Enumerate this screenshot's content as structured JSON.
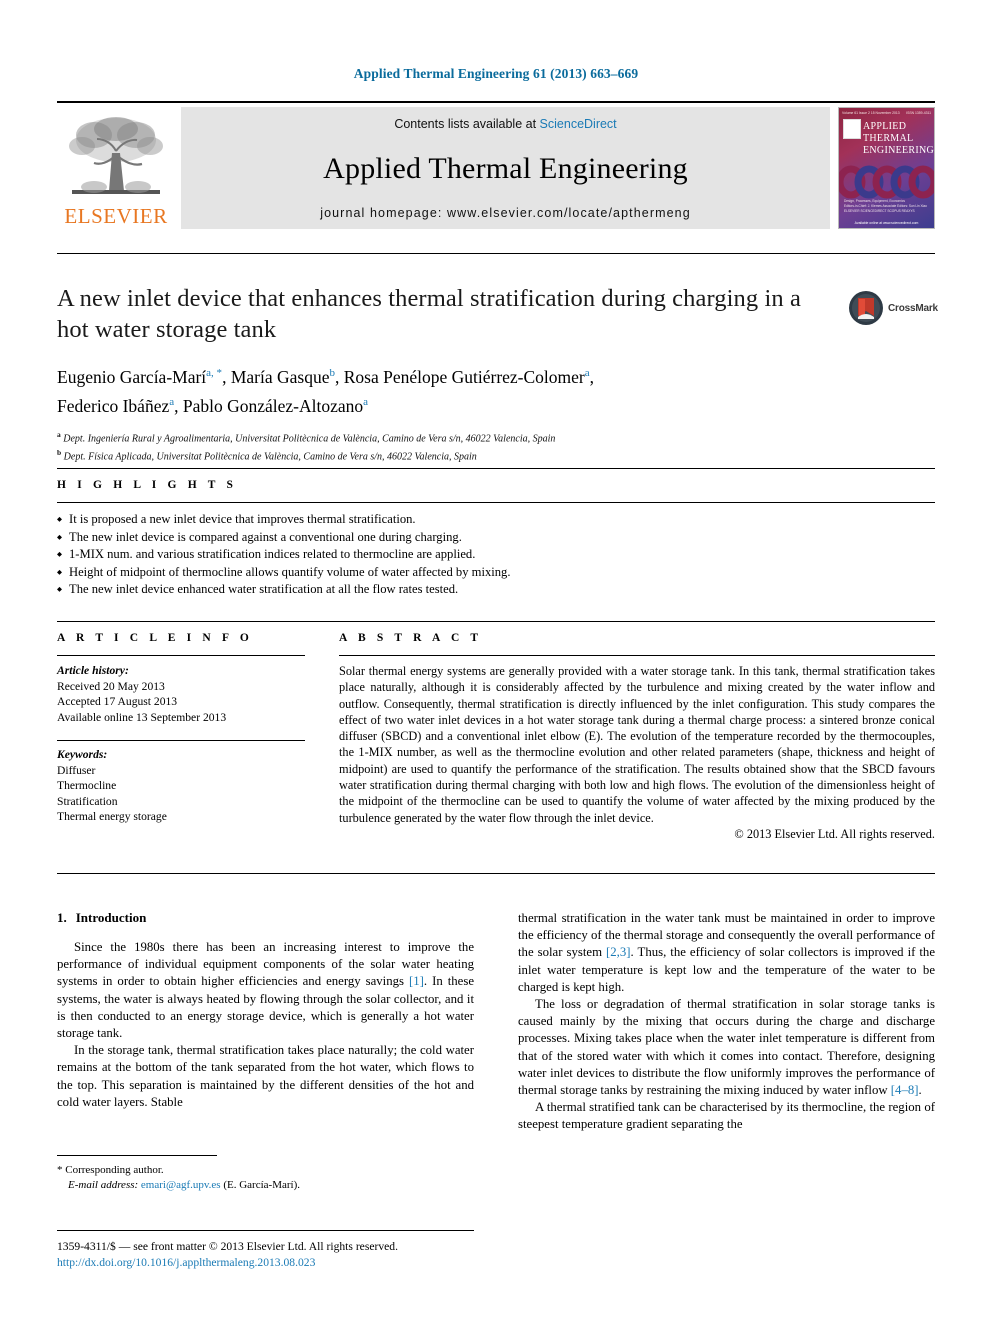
{
  "running_head": "Applied Thermal Engineering 61 (2013) 663–669",
  "masthead": {
    "publisher_name": "ELSEVIER",
    "contents_prefix": "Contents lists available at",
    "contents_link": "ScienceDirect",
    "journal_name": "Applied Thermal Engineering",
    "homepage": "journal homepage: www.elsevier.com/locate/apthermeng",
    "cover": {
      "line1": "APPLIED",
      "line2": "THERMAL",
      "line3": "ENGINEERING",
      "corner_left": "Volume 61  Issue 2  15 November 2013",
      "corner_right": "ISSN 1359-4311",
      "footer_a": "Design, Processes, Equipment, Economics",
      "footer_b": "Editors-in-Chief: J. Klemes  Associate Editors: Sun Lin Xiao",
      "footer_c": "ELSEVIER       SCIENCEDIRECT       SCOPUS       REAXYS",
      "badge": "Available online at www.sciencedirect.com"
    }
  },
  "article": {
    "title": "A new inlet device that enhances thermal stratification during charging in a hot water storage tank",
    "crossmark_label": "CrossMark",
    "authors": [
      {
        "name": "Eugenio García-Marí",
        "marks": "a, *"
      },
      {
        "name": "María Gasque",
        "marks": "b"
      },
      {
        "name": "Rosa Penélope Gutiérrez-Colomer",
        "marks": "a"
      },
      {
        "name": "Federico Ibáñez",
        "marks": "a"
      },
      {
        "name": "Pablo González-Altozano",
        "marks": "a"
      }
    ],
    "affiliations": [
      {
        "mark": "a",
        "text": "Dept. Ingeniería Rural y Agroalimentaria, Universitat Politècnica de València, Camino de Vera s/n, 46022 Valencia, Spain"
      },
      {
        "mark": "b",
        "text": "Dept. Física Aplicada, Universitat Politècnica de València, Camino de Vera s/n, 46022 Valencia, Spain"
      }
    ]
  },
  "highlights": {
    "label": "H I G H L I G H T S",
    "items": [
      "It is proposed a new inlet device that improves thermal stratification.",
      "The new inlet device is compared against a conventional one during charging.",
      "1-MIX num. and various stratification indices related to thermocline are applied.",
      "Height of midpoint of thermocline allows quantify volume of water affected by mixing.",
      "The new inlet device enhanced water stratification at all the flow rates tested."
    ]
  },
  "article_info": {
    "label": "A R T I C L E   I N F O",
    "history_label": "Article history:",
    "history": [
      "Received 20 May 2013",
      "Accepted 17 August 2013",
      "Available online 13 September 2013"
    ],
    "keywords_label": "Keywords:",
    "keywords": [
      "Diffuser",
      "Thermocline",
      "Stratification",
      "Thermal energy storage"
    ]
  },
  "abstract": {
    "label": "A B S T R A C T",
    "text": "Solar thermal energy systems are generally provided with a water storage tank. In this tank, thermal stratification takes place naturally, although it is considerably affected by the turbulence and mixing created by the water inflow and outflow. Consequently, thermal stratification is directly influenced by the inlet configuration. This study compares the effect of two water inlet devices in a hot water storage tank during a thermal charge process: a sintered bronze conical diffuser (SBCD) and a conventional inlet elbow (E). The evolution of the temperature recorded by the thermocouples, the 1-MIX number, as well as the thermocline evolution and other related parameters (shape, thickness and height of midpoint) are used to quantify the performance of the stratification. The results obtained show that the SBCD favours water stratification during thermal charging with both low and high flows. The evolution of the dimensionless height of the midpoint of the thermocline can be used to quantify the volume of water affected by the mixing produced by the turbulence generated by the water flow through the inlet device.",
    "copyright": "© 2013 Elsevier Ltd. All rights reserved."
  },
  "introduction": {
    "number": "1.",
    "heading": "Introduction",
    "left_paragraphs": [
      "Since the 1980s there has been an increasing interest to improve the performance of individual equipment components of the solar water heating systems in order to obtain higher efficiencies and energy savings [1]. In these systems, the water is always heated by flowing through the solar collector, and it is then conducted to an energy storage device, which is generally a hot water storage tank.",
      "In the storage tank, thermal stratification takes place naturally; the cold water remains at the bottom of the tank separated from the hot water, which flows to the top. This separation is maintained by the different densities of the hot and cold water layers. Stable"
    ],
    "right_paragraphs": [
      "thermal stratification in the water tank must be maintained in order to improve the efficiency of the thermal storage and consequently the overall performance of the solar system [2,3]. Thus, the efficiency of solar collectors is improved if the inlet water temperature is kept low and the temperature of the water to be charged is kept high.",
      "The loss or degradation of thermal stratification in solar storage tanks is caused mainly by the mixing that occurs during the charge and discharge processes. Mixing takes place when the water inlet temperature is different from that of the stored water with which it comes into contact. Therefore, designing water inlet devices to distribute the flow uniformly improves the performance of thermal storage tanks by restraining the mixing induced by water inflow [4–8].",
      "A thermal stratified tank can be characterised by its thermocline, the region of steepest temperature gradient separating the"
    ],
    "refs": {
      "r1": "[1]",
      "r23": "[2,3]",
      "r48": "[4–8]"
    }
  },
  "footnote": {
    "corresponding_marker": "*",
    "corresponding_label": "Corresponding author.",
    "email_label": "E-mail address:",
    "email": "emari@agf.upv.es",
    "email_owner": "(E. García-Marí)."
  },
  "footer": {
    "issn_line": "1359-4311/$ — see front matter © 2013 Elsevier Ltd. All rights reserved.",
    "doi": "http://dx.doi.org/10.1016/j.applthermaleng.2013.08.023"
  },
  "colors": {
    "link_blue": "#1a7ab5",
    "elsevier_orange": "#E87722",
    "band_gray": "#e4e4e4"
  }
}
